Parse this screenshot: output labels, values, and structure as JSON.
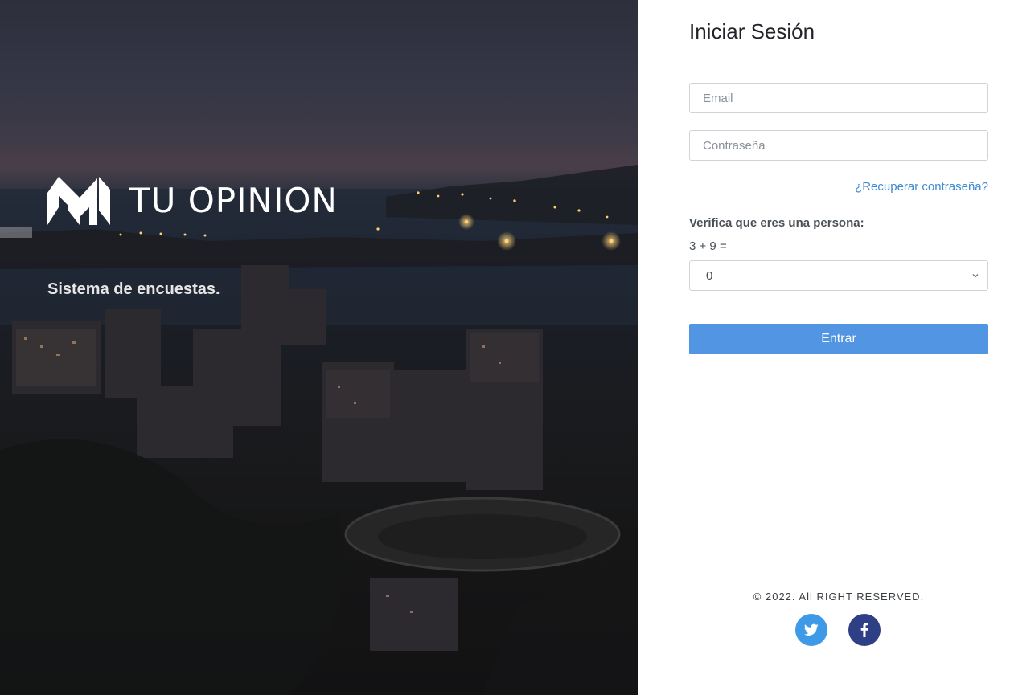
{
  "brand": {
    "name": "TU OPINION",
    "tagline": "Sistema de encuestas."
  },
  "login": {
    "title": "Iniciar Sesión",
    "email_placeholder": "Email",
    "password_placeholder": "Contraseña",
    "recover_link": "¿Recuperar contraseña?",
    "captcha_label": "Verifica que eres una persona:",
    "captcha_question": "3 + 9 =",
    "captcha_selected": "0",
    "submit_label": "Entrar"
  },
  "footer": {
    "copyright": "© 2022. All RIGHT RESERVED.",
    "social": [
      {
        "name": "twitter-icon",
        "color": "#3e9ae6"
      },
      {
        "name": "facebook-icon",
        "color": "#2f3f86"
      }
    ]
  },
  "colors": {
    "accent": "#5295e3",
    "link": "#3f8bd3",
    "twitter": "#3e9ae6",
    "facebook": "#2f3f86"
  }
}
